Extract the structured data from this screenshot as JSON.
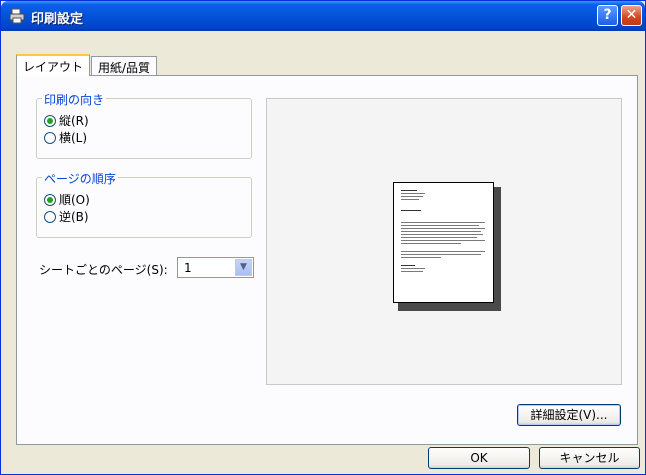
{
  "window": {
    "title": "印刷設定",
    "app_icon": "printer-icon",
    "help_icon": "?",
    "close_icon": "✕"
  },
  "tabs": [
    {
      "label": "レイアウト",
      "active": true
    },
    {
      "label": "用紙/品質",
      "active": false
    }
  ],
  "orientation": {
    "legend": "印刷の向き",
    "options": [
      {
        "label": "縦(R)",
        "checked": true
      },
      {
        "label": "横(L)",
        "checked": false
      }
    ]
  },
  "page_order": {
    "legend": "ページの順序",
    "options": [
      {
        "label": "順(O)",
        "checked": true
      },
      {
        "label": "逆(B)",
        "checked": false
      }
    ]
  },
  "pages_per_sheet": {
    "label": "シートごとのページ(S):",
    "value": "1"
  },
  "advanced_button": "詳細設定(V)...",
  "ok_button": "OK",
  "cancel_button": "キャンセル",
  "colors": {
    "title_bar": "#0453d8",
    "legend": "#0046d5",
    "radio_dot": "#21a121",
    "dialog_bg": "#ece9d8"
  }
}
